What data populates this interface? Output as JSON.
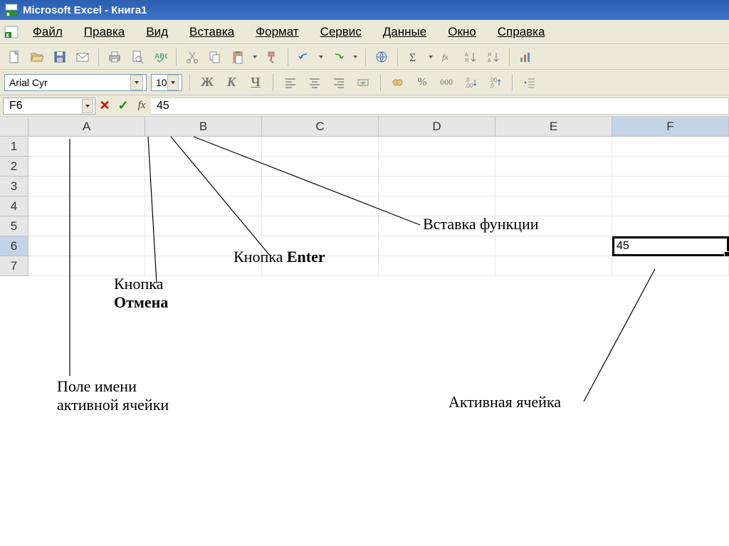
{
  "titlebar": {
    "title": "Microsoft Excel - Книга1"
  },
  "menu": {
    "file": "Файл",
    "edit": "Правка",
    "view": "Вид",
    "insert": "Вставка",
    "format": "Формат",
    "tools": "Сервис",
    "data": "Данные",
    "window": "Окно",
    "help": "Справка"
  },
  "format_bar": {
    "font": "Arial Cyr",
    "size": "10",
    "bold": "Ж",
    "italic": "К",
    "underline": "Ч",
    "currency": "%",
    "thousands": "000",
    "dec_inc": ",0",
    "dec_dec": ",00"
  },
  "formula_bar": {
    "name_box": "F6",
    "cancel": "✕",
    "enter": "✓",
    "fx": "fx",
    "value": "45"
  },
  "columns": [
    "A",
    "B",
    "C",
    "D",
    "E",
    "F"
  ],
  "rows": [
    "1",
    "2",
    "3",
    "4",
    "5",
    "6",
    "7"
  ],
  "active_column": "F",
  "active_row": "6",
  "active_cell_value": "45",
  "annotations": {
    "insert_fn": "Вставка функции",
    "enter_btn_pre": "Кнопка ",
    "enter_btn_bold": "Enter",
    "cancel_btn_pre": "Кнопка",
    "cancel_btn_bold": "Отмена",
    "name_field": "Поле имени\nактивной ячейки",
    "name_field_l1": "Поле имени",
    "name_field_l2": "активной ячейки",
    "active_cell": "Активная ячейка"
  }
}
